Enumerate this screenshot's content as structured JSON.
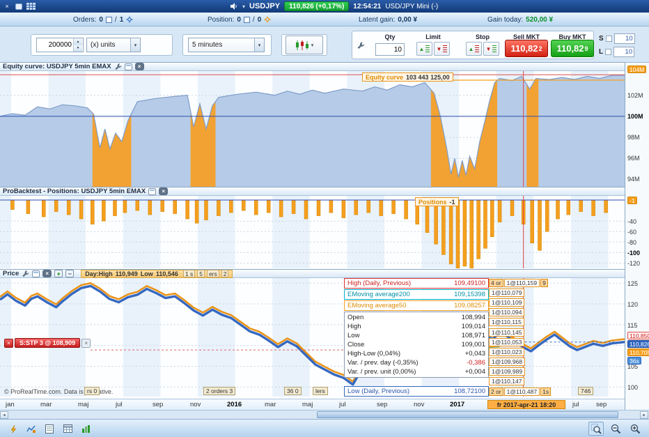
{
  "icons": {
    "close": "×",
    "caret": "▾",
    "up": "▲",
    "down": "▼",
    "left": "◂",
    "right": "▸",
    "slash": "/"
  },
  "titlebar": {
    "symbol": "USDJPY",
    "price_badge": "110,826 (+0,17%)",
    "time": "12:54:21",
    "instrument": "USD/JPY Mini (-)"
  },
  "statusbar": {
    "orders_label": "Orders:",
    "orders_open": "0",
    "orders_pending": "1",
    "position_label": "Position:",
    "position_open": "0",
    "position_pending": "0",
    "latent_label": "Latent gain:",
    "latent_value": "0,00 ¥",
    "gain_label": "Gain today:",
    "gain_value": "520,00 ¥"
  },
  "toolbar": {
    "quantity": "200000",
    "units": "(x) units",
    "timeframe": "5 minutes",
    "qty_label": "Qty",
    "qty_value": "10",
    "limit_label": "Limit",
    "stop_label": "Stop",
    "sell_label": "Sell MKT",
    "sell_price": "110,82",
    "sell_sup": "2",
    "buy_label": "Buy MKT",
    "buy_price": "110,82",
    "buy_sup": "9",
    "s_label": "S",
    "s_value": "10",
    "l_label": "L",
    "l_value": "10"
  },
  "equity_panel": {
    "title": "Equity curve: USDJPY 5min EMAX",
    "tag_label": "Equity curve",
    "tag_value": "103 443 125,00",
    "axis_badge": "104M",
    "axis": [
      {
        "label": "102M",
        "v": 102
      },
      {
        "label": "100M",
        "v": 100,
        "bold": true
      },
      {
        "label": "98M",
        "v": 98
      },
      {
        "label": "96M",
        "v": 96
      },
      {
        "label": "94M",
        "v": 94
      }
    ]
  },
  "positions_panel": {
    "title": "ProBacktest - Positions: USDJPY 5min EMAX",
    "tag_label": "Positions",
    "tag_value": "-1",
    "axis_badge": "-1",
    "axis": [
      {
        "label": "-40",
        "v": -40
      },
      {
        "label": "-60",
        "v": -60
      },
      {
        "label": "-80",
        "v": -80
      },
      {
        "label": "-100",
        "v": -100,
        "bold": true
      },
      {
        "label": "-120",
        "v": -120
      }
    ]
  },
  "price_panel": {
    "title": "Price",
    "day_high_label": "Day:High",
    "day_high": "110,949",
    "day_low_label": "Low",
    "day_low": "110,546",
    "strip_tags": [
      "1 s",
      "5",
      "ers",
      "2"
    ],
    "info_rows": [
      {
        "label": "High (Daily, Previous)",
        "value": "109,49100",
        "style": "high"
      },
      {
        "label": "EMoving average200",
        "value": "109,15398",
        "style": "ema200"
      },
      {
        "label": "EMoving average50",
        "value": "109,08257",
        "style": "ema50"
      }
    ],
    "quote_rows": [
      {
        "label": "Open",
        "value": "108,994"
      },
      {
        "label": "High",
        "value": "109,014"
      },
      {
        "label": "Low",
        "value": "108,971"
      },
      {
        "label": "Close",
        "value": "109,001"
      },
      {
        "label": "High-Low (0,04%)",
        "value": "+0,043"
      },
      {
        "label": "Var. / prev. day (-0,35%)",
        "value": "-0,386",
        "style": "neg"
      },
      {
        "label": "Var. / prev. unit (0,00%)",
        "value": "+0,004"
      }
    ],
    "low_row": {
      "label": "Low (Daily, Previous)",
      "value": "108,72100"
    },
    "ladder": [
      {
        "prefix": "4 or",
        "text": "1@110,159",
        "suffix": "9"
      },
      {
        "text": "1@110,079"
      },
      {
        "text": "1@110,109"
      },
      {
        "text": "1@110,094"
      },
      {
        "text": "1@110,115"
      },
      {
        "text": "1@110,145"
      },
      {
        "text": "1@110,053"
      },
      {
        "text": "1@110,023"
      },
      {
        "text": "1@109,968"
      },
      {
        "text": "1@109,989"
      },
      {
        "text": "1@110,147"
      },
      {
        "prefix": "2 or",
        "text": "1@110,487",
        "suffix": "1s"
      }
    ],
    "stop_tag": "S:STP 3 @ 108,909",
    "bottom_tags": [
      {
        "text": "rs 0",
        "x": 0.135
      },
      {
        "text": "2 orders 3",
        "x": 0.325
      },
      {
        "text": "36 0",
        "x": 0.455
      },
      {
        "text": "lers",
        "x": 0.5
      },
      {
        "text": "746",
        "x": 0.925
      }
    ],
    "watermark": "© ProRealTime.com. Data is indicative.",
    "axis": [
      {
        "label": "125",
        "v": 125
      },
      {
        "label": "120",
        "v": 120
      },
      {
        "label": "115",
        "v": 115
      },
      {
        "label": "105",
        "v": 105
      },
      {
        "label": "100",
        "v": 100
      }
    ],
    "badges": [
      {
        "label": "110,850",
        "style": "high"
      },
      {
        "label": "110,826",
        "style": "current"
      },
      {
        "label": "110,705",
        "style": "stop"
      },
      {
        "label": "36s",
        "style": "countdown"
      }
    ]
  },
  "xaxis": {
    "labels": [
      {
        "t": "jan",
        "x": 0.02
      },
      {
        "t": "mar",
        "x": 0.076
      },
      {
        "t": "maj",
        "x": 0.136
      },
      {
        "t": "jul",
        "x": 0.196
      },
      {
        "t": "sep",
        "x": 0.255
      },
      {
        "t": "nov",
        "x": 0.315
      },
      {
        "t": "2016",
        "x": 0.375,
        "bold": true
      },
      {
        "t": "mar",
        "x": 0.435
      },
      {
        "t": "maj",
        "x": 0.495
      },
      {
        "t": "jul",
        "x": 0.554
      },
      {
        "t": "sep",
        "x": 0.614
      },
      {
        "t": "nov",
        "x": 0.673
      },
      {
        "t": "2017",
        "x": 0.731,
        "bold": true
      },
      {
        "t": "jul",
        "x": 0.927
      },
      {
        "t": "sep",
        "x": 0.965
      }
    ],
    "cursor_label": "fr 2017-apr-21 18:20"
  },
  "chart_data": {
    "equity": {
      "type": "area",
      "title": "Equity curve",
      "ylim": [
        94,
        104
      ],
      "unit": "M",
      "points": [
        [
          0,
          100
        ],
        [
          0.02,
          100.25
        ],
        [
          0.04,
          100.1
        ],
        [
          0.06,
          100.9
        ],
        [
          0.08,
          100.7
        ],
        [
          0.1,
          101.1
        ],
        [
          0.12,
          101.0
        ],
        [
          0.14,
          100.8
        ],
        [
          0.15,
          100.2
        ],
        [
          0.16,
          97.0
        ],
        [
          0.168,
          98.8
        ],
        [
          0.176,
          96.9
        ],
        [
          0.185,
          98.4
        ],
        [
          0.195,
          97.6
        ],
        [
          0.205,
          99.6
        ],
        [
          0.22,
          101.4
        ],
        [
          0.25,
          101.7
        ],
        [
          0.28,
          101.9
        ],
        [
          0.3,
          102.0
        ],
        [
          0.31,
          99.0
        ],
        [
          0.32,
          101.2
        ],
        [
          0.33,
          98.8
        ],
        [
          0.34,
          101.0
        ],
        [
          0.35,
          101.8
        ],
        [
          0.38,
          102.1
        ],
        [
          0.41,
          102.3
        ],
        [
          0.44,
          102.0
        ],
        [
          0.46,
          102.4
        ],
        [
          0.48,
          102.1
        ],
        [
          0.5,
          102.5
        ],
        [
          0.52,
          102.2
        ],
        [
          0.55,
          102.6
        ],
        [
          0.58,
          102.4
        ],
        [
          0.6,
          102.8
        ],
        [
          0.62,
          102.5
        ],
        [
          0.64,
          103.0
        ],
        [
          0.66,
          102.8
        ],
        [
          0.68,
          103.2
        ],
        [
          0.695,
          102.2
        ],
        [
          0.705,
          100.0
        ],
        [
          0.715,
          97.0
        ],
        [
          0.722,
          94.5
        ],
        [
          0.728,
          96.0
        ],
        [
          0.734,
          94.2
        ],
        [
          0.74,
          95.8
        ],
        [
          0.746,
          94.4
        ],
        [
          0.752,
          96.2
        ],
        [
          0.76,
          95.0
        ],
        [
          0.768,
          97.6
        ],
        [
          0.776,
          99.5
        ],
        [
          0.784,
          101.5
        ],
        [
          0.792,
          103.2
        ],
        [
          0.8,
          103.6
        ],
        [
          0.82,
          103.4
        ],
        [
          0.835,
          103.8
        ],
        [
          0.848,
          102.6
        ],
        [
          0.858,
          103.6
        ],
        [
          0.88,
          103.5
        ],
        [
          0.9,
          103.7
        ],
        [
          0.92,
          103.5
        ],
        [
          0.94,
          103.8
        ],
        [
          0.96,
          103.6
        ],
        [
          0.98,
          103.9
        ],
        [
          1,
          103.9
        ]
      ],
      "drawdowns": [
        [
          0.148,
          0.21
        ],
        [
          0.305,
          0.345
        ],
        [
          0.69,
          0.796
        ],
        [
          0.843,
          0.862
        ]
      ],
      "baseline": 100,
      "high_line": 103.95,
      "current": 103.44,
      "current_x": 0.58
    },
    "positions": {
      "type": "bar",
      "title": "Positions",
      "ylim": [
        -130,
        0
      ],
      "bars": [
        [
          0.02,
          18
        ],
        [
          0.045,
          26
        ],
        [
          0.07,
          32
        ],
        [
          0.09,
          22
        ],
        [
          0.11,
          28
        ],
        [
          0.13,
          36
        ],
        [
          0.148,
          46
        ],
        [
          0.166,
          40
        ],
        [
          0.184,
          30
        ],
        [
          0.2,
          24
        ],
        [
          0.22,
          20
        ],
        [
          0.24,
          28
        ],
        [
          0.26,
          22
        ],
        [
          0.28,
          26
        ],
        [
          0.3,
          36
        ],
        [
          0.315,
          44
        ],
        [
          0.33,
          38
        ],
        [
          0.35,
          30
        ],
        [
          0.37,
          24
        ],
        [
          0.39,
          20
        ],
        [
          0.41,
          28
        ],
        [
          0.43,
          24
        ],
        [
          0.45,
          32
        ],
        [
          0.47,
          26
        ],
        [
          0.49,
          36
        ],
        [
          0.51,
          30
        ],
        [
          0.53,
          24
        ],
        [
          0.55,
          34
        ],
        [
          0.57,
          28
        ],
        [
          0.59,
          24
        ],
        [
          0.61,
          30
        ],
        [
          0.63,
          26
        ],
        [
          0.65,
          36
        ],
        [
          0.668,
          46
        ],
        [
          0.684,
          62
        ],
        [
          0.698,
          84
        ],
        [
          0.71,
          104
        ],
        [
          0.722,
          122
        ],
        [
          0.733,
          130
        ],
        [
          0.744,
          126
        ],
        [
          0.755,
          130
        ],
        [
          0.766,
          112
        ],
        [
          0.777,
          92
        ],
        [
          0.788,
          70
        ],
        [
          0.8,
          42
        ],
        [
          0.82,
          30
        ],
        [
          0.838,
          46
        ],
        [
          0.852,
          82
        ],
        [
          0.864,
          96
        ],
        [
          0.876,
          60
        ],
        [
          0.893,
          36
        ],
        [
          0.91,
          28
        ],
        [
          0.93,
          22
        ],
        [
          0.95,
          30
        ],
        [
          0.97,
          24
        ]
      ],
      "current": -1
    },
    "price": {
      "type": "line",
      "title": "USDJPY 5 minutes",
      "ylim": [
        100,
        125
      ],
      "points": [
        [
          0,
          121
        ],
        [
          0.012,
          122.3
        ],
        [
          0.025,
          120.8
        ],
        [
          0.04,
          119.6
        ],
        [
          0.05,
          121.2
        ],
        [
          0.06,
          121.8
        ],
        [
          0.075,
          120.4
        ],
        [
          0.09,
          119.2
        ],
        [
          0.1,
          120.6
        ],
        [
          0.115,
          122.4
        ],
        [
          0.13,
          123.8
        ],
        [
          0.145,
          124.3
        ],
        [
          0.16,
          123.0
        ],
        [
          0.175,
          121.2
        ],
        [
          0.19,
          120.4
        ],
        [
          0.205,
          121.6
        ],
        [
          0.22,
          122.2
        ],
        [
          0.235,
          123.6
        ],
        [
          0.25,
          122.6
        ],
        [
          0.265,
          121.4
        ],
        [
          0.28,
          121.8
        ],
        [
          0.295,
          120.2
        ],
        [
          0.31,
          118.4
        ],
        [
          0.325,
          117.2
        ],
        [
          0.34,
          118.6
        ],
        [
          0.355,
          117.4
        ],
        [
          0.37,
          116.6
        ],
        [
          0.385,
          115.0
        ],
        [
          0.4,
          113.4
        ],
        [
          0.415,
          112.6
        ],
        [
          0.43,
          111.2
        ],
        [
          0.445,
          109.6
        ],
        [
          0.46,
          111.0
        ],
        [
          0.475,
          109.8
        ],
        [
          0.49,
          107.6
        ],
        [
          0.505,
          105.4
        ],
        [
          0.52,
          104.2
        ],
        [
          0.535,
          103.0
        ],
        [
          0.55,
          102.2
        ],
        [
          0.565,
          100.6
        ],
        [
          0.575,
          103.2
        ],
        [
          0.59,
          104.6
        ],
        [
          0.605,
          103.4
        ],
        [
          0.62,
          105.2
        ],
        [
          0.635,
          107.0
        ],
        [
          0.65,
          109.2
        ],
        [
          0.665,
          111.4
        ],
        [
          0.68,
          113.6
        ],
        [
          0.695,
          115.8
        ],
        [
          0.705,
          117.2
        ],
        [
          0.715,
          116.2
        ],
        [
          0.73,
          114.8
        ],
        [
          0.745,
          113.4
        ],
        [
          0.76,
          112.8
        ],
        [
          0.775,
          112.2
        ],
        [
          0.79,
          111.6
        ],
        [
          0.8,
          113.2
        ],
        [
          0.81,
          112.4
        ],
        [
          0.825,
          110.8
        ],
        [
          0.84,
          109.4
        ],
        [
          0.85,
          108.6
        ],
        [
          0.862,
          110.0
        ],
        [
          0.875,
          111.4
        ],
        [
          0.888,
          112.6
        ],
        [
          0.9,
          111.2
        ],
        [
          0.912,
          109.8
        ],
        [
          0.924,
          108.9
        ],
        [
          0.936,
          109.6
        ],
        [
          0.95,
          110.4
        ],
        [
          0.965,
          109.9
        ],
        [
          0.98,
          110.5
        ],
        [
          1,
          110.83
        ]
      ],
      "current": 110.826,
      "stop": 108.909,
      "ema_segments": [
        {
          "color": "#e03030",
          "pts": [
            [
              0.72,
              109.5
            ],
            [
              0.78,
              109.9
            ],
            [
              0.8,
              110.1
            ]
          ]
        },
        {
          "color": "#00b0c8",
          "pts": [
            [
              0.72,
              109.15
            ],
            [
              0.78,
              109.5
            ],
            [
              0.8,
              109.7
            ]
          ]
        },
        {
          "color": "#f59f1e",
          "pts": [
            [
              0.72,
              109.08
            ],
            [
              0.78,
              109.6
            ],
            [
              0.8,
              109.8
            ]
          ]
        }
      ]
    }
  }
}
